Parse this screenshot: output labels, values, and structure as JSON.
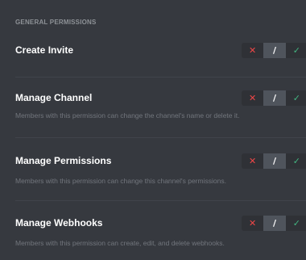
{
  "section": {
    "title": "GENERAL PERMISSIONS"
  },
  "toggle_labels": {
    "deny": "✕",
    "passthrough": "/",
    "allow": "✓"
  },
  "colors": {
    "deny": "#f04747",
    "allow": "#43b581",
    "background": "#36393f"
  },
  "permissions": [
    {
      "name": "Create Invite",
      "description": "",
      "state": "passthrough"
    },
    {
      "name": "Manage Channel",
      "description": "Members with this permission can change the channel's name or delete it.",
      "state": "passthrough"
    },
    {
      "name": "Manage Permissions",
      "description": "Members with this permission can change this channel's permissions.",
      "state": "passthrough"
    },
    {
      "name": "Manage Webhooks",
      "description": "Members with this permission can create, edit, and delete webhooks.",
      "state": "passthrough"
    }
  ]
}
